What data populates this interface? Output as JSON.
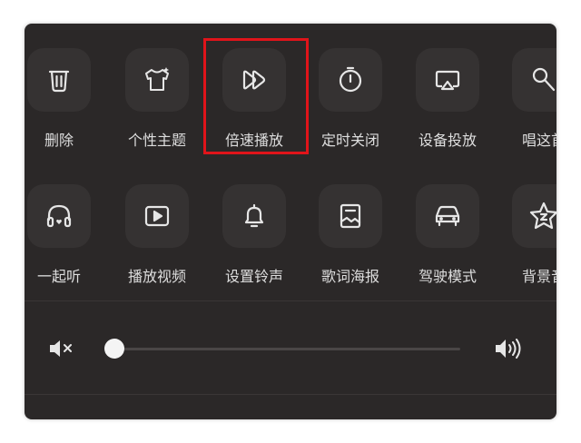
{
  "row1": [
    {
      "label": "删除",
      "icon": "trash-icon"
    },
    {
      "label": "个性主题",
      "icon": "tshirt-icon"
    },
    {
      "label": "倍速播放",
      "icon": "fast-forward-icon"
    },
    {
      "label": "定时关闭",
      "icon": "timer-icon"
    },
    {
      "label": "设备投放",
      "icon": "cast-icon"
    },
    {
      "label": "唱这首",
      "icon": "microphone-icon"
    }
  ],
  "row2": [
    {
      "label": "一起听",
      "icon": "headphones-icon"
    },
    {
      "label": "播放视频",
      "icon": "video-play-icon"
    },
    {
      "label": "设置铃声",
      "icon": "bell-icon"
    },
    {
      "label": "歌词海报",
      "icon": "lyrics-poster-icon"
    },
    {
      "label": "驾驶模式",
      "icon": "car-icon"
    },
    {
      "label": "背景音",
      "icon": "star-music-icon"
    }
  ],
  "volume": {
    "level": 0.0
  },
  "colors": {
    "highlight": "#e0141a",
    "panel": "#2b2828"
  }
}
